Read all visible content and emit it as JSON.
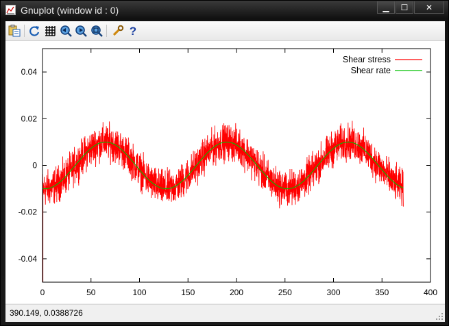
{
  "window": {
    "title": "Gnuplot (window id : 0)",
    "minimize_glyph": "▁",
    "maximize_glyph": "☐",
    "close_glyph": "✕"
  },
  "toolbar": {
    "buttons": [
      {
        "icon": "copy-to-clipboard-icon"
      },
      {
        "icon": "replot-icon"
      },
      {
        "icon": "grid-icon"
      },
      {
        "icon": "zoom-previous-icon"
      },
      {
        "icon": "zoom-next-icon"
      },
      {
        "icon": "unzoom-icon"
      },
      {
        "icon": "options-wrench-icon"
      },
      {
        "icon": "help-icon"
      }
    ]
  },
  "status": {
    "coordinates": "390.149,  0.0388726"
  },
  "colors": {
    "series_stress": "#ff0000",
    "series_rate": "#00c000"
  },
  "chart_data": {
    "type": "line",
    "title": "",
    "xlabel": "",
    "ylabel": "",
    "xlim": [
      0,
      400
    ],
    "ylim": [
      -0.05,
      0.05
    ],
    "xticks": [
      0,
      50,
      100,
      150,
      200,
      250,
      300,
      350,
      400
    ],
    "xtick_labels": [
      "0",
      "50",
      "100",
      "150",
      "200",
      "250",
      "300",
      "350",
      "400"
    ],
    "yticks": [
      -0.04,
      -0.02,
      0,
      0.02,
      0.04
    ],
    "ytick_labels": [
      "-0.04",
      "-0.02",
      "0",
      "0.02",
      "0.04"
    ],
    "grid": false,
    "legend_position": "top-right",
    "series": [
      {
        "name": "Shear stress",
        "style": "noisy sinusoid",
        "amplitude": 0.01,
        "period": 125,
        "phase_peak_x": 65,
        "noise_peak_to_peak": 0.022,
        "x_range": [
          0,
          372
        ],
        "x": [
          0,
          30,
          65,
          95,
          125,
          160,
          190,
          220,
          250,
          285,
          315,
          345,
          372
        ],
        "y": [
          -0.01,
          0.0,
          0.01,
          0.0,
          -0.01,
          0.0,
          0.01,
          0.0,
          -0.01,
          0.0,
          0.01,
          0.0,
          -0.01
        ]
      },
      {
        "name": "Shear rate",
        "style": "sinusoid",
        "amplitude": 0.01,
        "period": 125,
        "phase_peak_x": 65,
        "x_range": [
          0,
          372
        ],
        "x": [
          0,
          30,
          65,
          95,
          125,
          160,
          190,
          220,
          250,
          285,
          315,
          345,
          372
        ],
        "y": [
          -0.01,
          0.0,
          0.01,
          0.0,
          -0.01,
          0.0,
          0.01,
          0.0,
          -0.01,
          0.0,
          0.01,
          0.0,
          -0.01
        ]
      }
    ]
  }
}
